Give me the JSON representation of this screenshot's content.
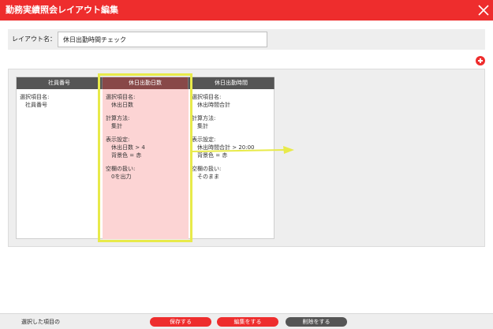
{
  "window": {
    "title": "勤務実績照会レイアウト編集",
    "close_icon": "close-icon"
  },
  "layout_name": {
    "label": "レイアウト名：",
    "value": "休日出勤時間チェック"
  },
  "columns": [
    {
      "header": "社員番号",
      "item_label": "選択項目名:",
      "item_value": "社員番号"
    },
    {
      "header": "休日出勤日数",
      "item_label": "選択項目名:",
      "item_value": "休出日数",
      "calc_label": "計算方法:",
      "calc_value": "集計",
      "display_label": "表示設定:",
      "display_condition": "休出日数 > 4",
      "display_color": "背景色 = 赤",
      "empty_label": "空欄の扱い:",
      "empty_value": "0を出力"
    },
    {
      "header": "休日出勤時間",
      "item_label": "選択項目名:",
      "item_value": "休出時間合計",
      "calc_label": "計算方法:",
      "calc_value": "集計",
      "display_label": "表示設定:",
      "display_condition": "休出時間合計 > 20:00",
      "display_color": "背景色 = 赤",
      "empty_label": "空欄の扱い:",
      "empty_value": "そのまま"
    }
  ],
  "footer": {
    "selected_note": "選択した項目の",
    "save_label": "保存する",
    "edit_label": "編集をする",
    "delete_label": "削除をする"
  },
  "colors": {
    "accent": "#ee2d2d",
    "header": "#555555",
    "selected_header": "#884848",
    "selected_bg": "#fcd4d4",
    "highlight": "#e8ea4a"
  }
}
